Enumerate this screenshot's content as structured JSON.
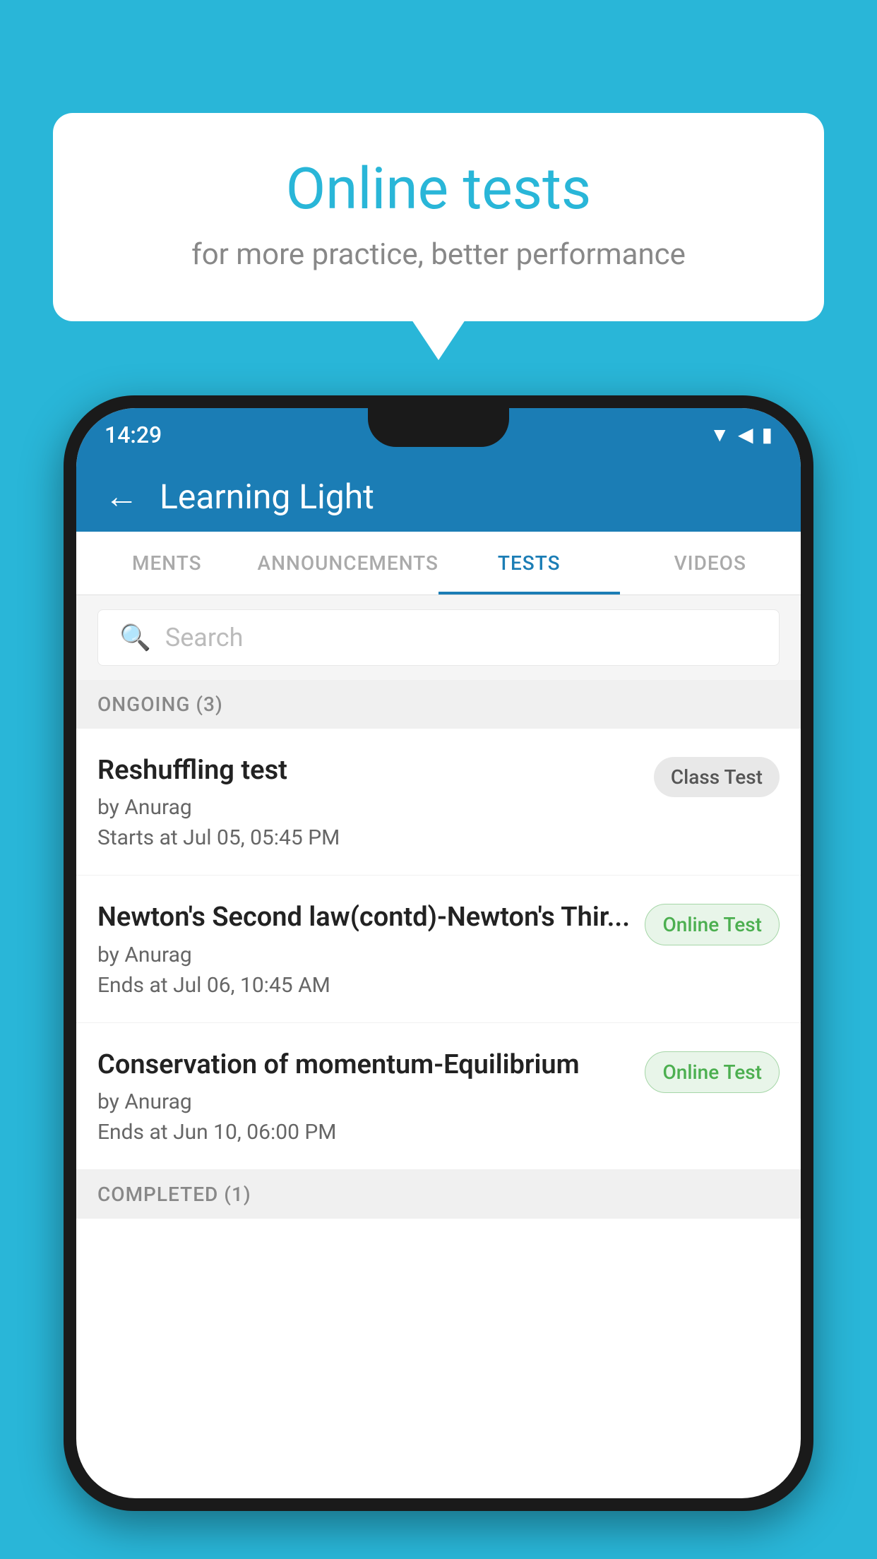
{
  "background": {
    "color": "#29b6d8"
  },
  "speech_bubble": {
    "title": "Online tests",
    "subtitle": "for more practice, better performance"
  },
  "phone": {
    "status_bar": {
      "time": "14:29",
      "icons": [
        "wifi",
        "signal",
        "battery"
      ]
    },
    "header": {
      "title": "Learning Light",
      "back_label": "←"
    },
    "tabs": [
      {
        "label": "MENTS",
        "active": false
      },
      {
        "label": "ANNOUNCEMENTS",
        "active": false
      },
      {
        "label": "TESTS",
        "active": true
      },
      {
        "label": "VIDEOS",
        "active": false
      }
    ],
    "search": {
      "placeholder": "Search"
    },
    "ongoing_section": {
      "label": "ONGOING (3)"
    },
    "tests": [
      {
        "name": "Reshuffling test",
        "author": "by Anurag",
        "time_label": "Starts at",
        "time": "Jul 05, 05:45 PM",
        "badge": "Class Test",
        "badge_type": "class"
      },
      {
        "name": "Newton's Second law(contd)-Newton's Thir...",
        "author": "by Anurag",
        "time_label": "Ends at",
        "time": "Jul 06, 10:45 AM",
        "badge": "Online Test",
        "badge_type": "online"
      },
      {
        "name": "Conservation of momentum-Equilibrium",
        "author": "by Anurag",
        "time_label": "Ends at",
        "time": "Jun 10, 06:00 PM",
        "badge": "Online Test",
        "badge_type": "online"
      }
    ],
    "completed_section": {
      "label": "COMPLETED (1)"
    }
  }
}
